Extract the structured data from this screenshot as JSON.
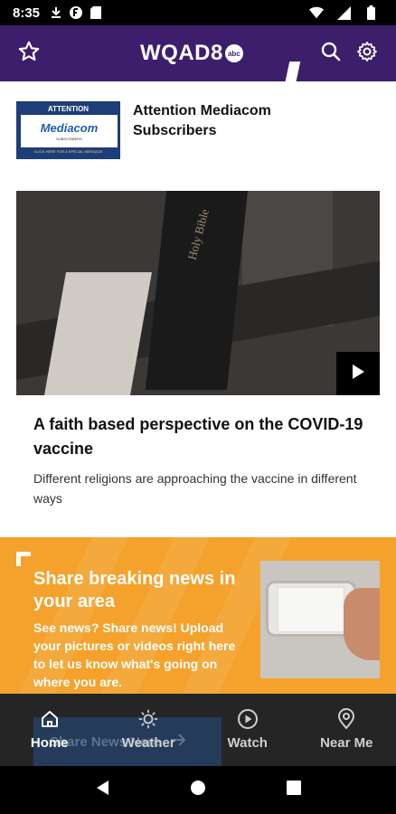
{
  "status_bar": {
    "time": "8:35",
    "icons": [
      "download-icon",
      "app-icon",
      "sd-card-icon",
      "wifi-icon",
      "signal-icon",
      "battery-icon"
    ]
  },
  "header": {
    "logo_text": "WQAD8",
    "logo_badge": "abc",
    "left_icon": "star-icon",
    "right_icons": [
      "search-icon",
      "gear-icon"
    ],
    "brand_color": "#3d1e6d"
  },
  "promo": {
    "thumb_top": "ATTENTION",
    "thumb_brand": "Mediacom",
    "thumb_sub": "SUBSCRIBERS",
    "thumb_bottom": "CLICK HERE FOR A SPECIAL MESSAGE",
    "title": "Attention Mediacom Subscribers"
  },
  "hero": {
    "book_text": "Holy Bible",
    "play_icon": "play-icon"
  },
  "article": {
    "headline": "A faith based perspective on the COVID-19 vaccine",
    "subhead": "Different religions are approaching the vaccine in different ways"
  },
  "banner": {
    "title": "Share breaking news in your area",
    "body": "See news? Share news! Upload your pictures or videos right here to let us know what's going on where you are.",
    "button_label": "Share News Here",
    "accent_color": "#f4a22c"
  },
  "bottom_nav": {
    "items": [
      {
        "label": "Home",
        "icon": "home-icon",
        "active": true
      },
      {
        "label": "Weather",
        "icon": "sun-icon",
        "active": false
      },
      {
        "label": "Watch",
        "icon": "play-circle-icon",
        "active": false
      },
      {
        "label": "Near Me",
        "icon": "location-pin-icon",
        "active": false
      }
    ]
  },
  "system_nav": {
    "icons": [
      "back-icon",
      "home-circle-icon",
      "recents-icon"
    ]
  }
}
